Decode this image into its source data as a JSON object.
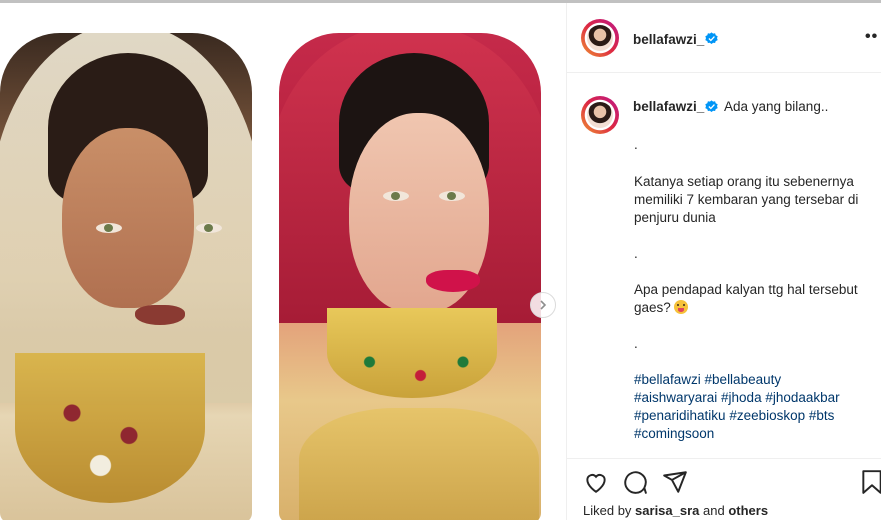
{
  "post": {
    "username": "bellafawzi_",
    "more_label": "••",
    "caption_intro": "Ada yang bilang..",
    "caption_lines": [
      ".",
      "Katanya setiap orang itu sebenernya",
      "memiliki 7 kembaran yang tersebar di",
      "penjuru dunia",
      ".",
      "Apa pendapad kalyan ttg hal tersebut",
      "gaes?",
      "."
    ],
    "hashtag_lines": [
      "#bellafawzi #bellabeauty",
      "#aishwaryarai #jhoda #jhodaakbar",
      "#penaridihatiku #zeebioskop #bts",
      "#comingsoon"
    ],
    "liked_by_prefix": "Liked by",
    "liked_by_user": "sarisa_sra",
    "liked_by_and": "and",
    "liked_by_others": "others"
  },
  "colors": {
    "accent_blue": "#0095f6",
    "hashtag": "#00376b",
    "text": "#262626"
  },
  "icons": [
    "verified-badge-icon",
    "more-options-icon",
    "heart-icon",
    "comment-icon",
    "share-icon",
    "bookmark-icon",
    "chevron-right-icon",
    "tongue-emoji-icon"
  ]
}
